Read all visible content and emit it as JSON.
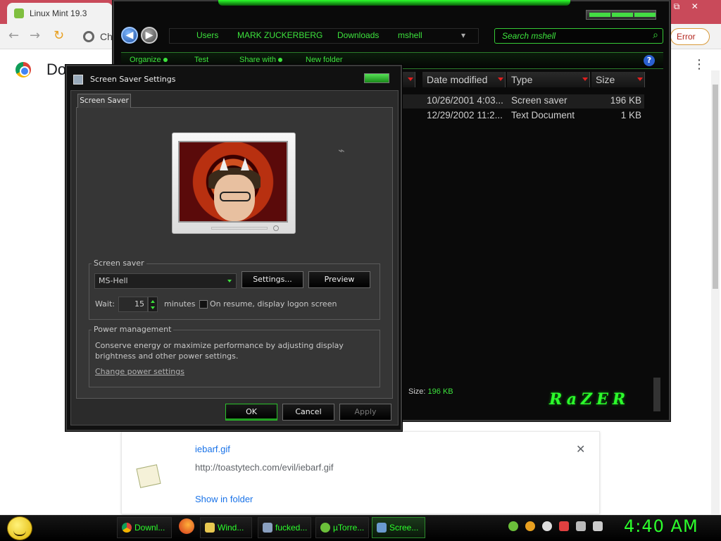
{
  "chrome": {
    "tab_title": "Linux Mint 19.3",
    "address_fragment": "Ch",
    "error_badge": "Error",
    "page_title": "Dow",
    "kebab": "⋮",
    "nav_back": "←",
    "nav_forward": "→",
    "nav_reload": "↻",
    "window_buttons": [
      "⧉",
      "✕"
    ]
  },
  "download": {
    "filename": "iebarf.gif",
    "url": "http://toastytech.com/evil/iebarf.gif",
    "show_in_folder": "Show in folder",
    "close": "✕"
  },
  "explorer": {
    "breadcrumbs": [
      "Users",
      "MARK ZUCKERBERG",
      "Downloads",
      "mshell"
    ],
    "search_placeholder": "Search mshell",
    "commands": [
      "Organize",
      "Test",
      "Share with",
      "New folder"
    ],
    "help": "?",
    "columns": [
      "Date modified",
      "Type",
      "Size"
    ],
    "files": [
      {
        "date": "10/26/2001 4:03...",
        "type": "Screen saver",
        "size": "196 KB"
      },
      {
        "date": "12/29/2002 11:2...",
        "type": "Text Document",
        "size": "1 KB"
      }
    ],
    "status_label": "Size:",
    "status_value": "196 KB",
    "brand": "RaZER"
  },
  "dialog": {
    "title": "Screen Saver Settings",
    "tab": "Screen Saver",
    "screensaver_group": "Screen saver",
    "selected_screensaver": "MS-Hell",
    "settings_button": "Settings...",
    "preview_button": "Preview",
    "wait_label": "Wait:",
    "wait_value": "15",
    "minutes_label": "minutes",
    "resume_label": "On resume, display logon screen",
    "power_group": "Power management",
    "power_desc": "Conserve energy or maximize performance by adjusting display brightness and other power settings.",
    "power_link": "Change power settings",
    "ok": "OK",
    "cancel": "Cancel",
    "apply": "Apply"
  },
  "taskbar": {
    "items": [
      "Downl...",
      "Wind...",
      "fucked...",
      "µTorre...",
      "Scree..."
    ],
    "clock": "4:40 AM"
  },
  "colors": {
    "accent_green": "#2cff2c",
    "chrome_tab_bar": "#c94a5a",
    "link_blue": "#1a73e8"
  }
}
